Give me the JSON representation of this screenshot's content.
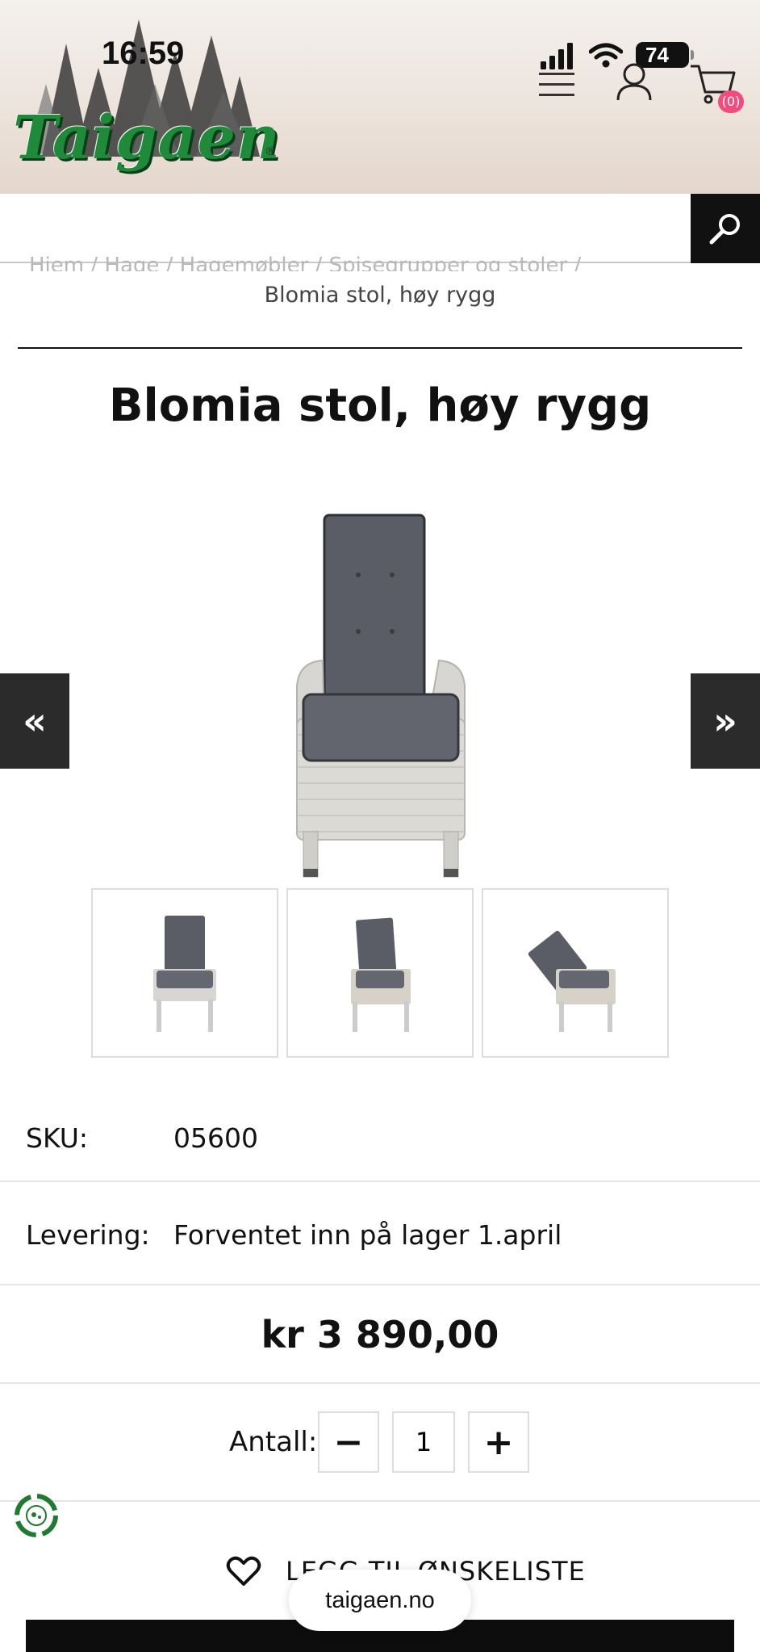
{
  "status_bar": {
    "time": "16:59",
    "battery": "74"
  },
  "header": {
    "logo_text": "Taigaen",
    "logo_reg": "®",
    "cart_count": "(0)"
  },
  "search": {
    "placeholder": ""
  },
  "breadcrumb": {
    "faded": "Hjem  /  Hage  /  Hagemøbler  /  Spisegrupper og stoler  /",
    "current": "Blomia stol, høy rygg"
  },
  "product": {
    "title": "Blomia stol, høy rygg",
    "gallery_prev": "«",
    "gallery_next": "»",
    "sku_label": "SKU:",
    "sku_value": "05600",
    "delivery_label": "Levering:",
    "delivery_value": "Forventet inn på lager 1.april",
    "price": "kr 3 890,00",
    "quantity_label": "Antall:",
    "quantity_value": "1",
    "minus": "−",
    "plus": "+",
    "wishlist_label": "LEGG TIL ØNSKELISTE"
  },
  "browser": {
    "url": "taigaen.no"
  },
  "colors": {
    "brand_green": "#1f8a3a",
    "cart_badge": "#f04c7e",
    "dark": "#111111"
  }
}
